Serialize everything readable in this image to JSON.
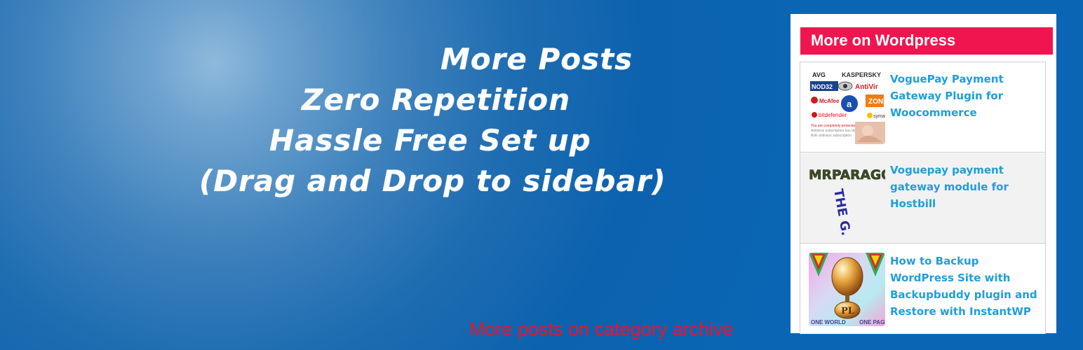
{
  "hero": {
    "lines": [
      "More Posts",
      "Zero Repetition",
      "Hassle Free Set up",
      "(Drag and Drop to sidebar)"
    ],
    "footer_link": "More posts on category archive"
  },
  "widget": {
    "title": "More on Wordpress",
    "posts": [
      {
        "title": "VoguePay Payment Gateway Plugin for Woocommerce",
        "thumbnail": "antivirus-logos-image"
      },
      {
        "title": "Voguepay payment gateway module for Hostbill",
        "thumbnail": "mrparagon-geek-logo-image"
      },
      {
        "title": "How to Backup WordPress Site with Backupbuddy plugin and Restore with InstantWP",
        "thumbnail": "pl-one-world-one-page-logo-image"
      }
    ]
  },
  "colors": {
    "background": "#0a66b5",
    "widget_header": "#f0154f",
    "post_link": "#1f9edc",
    "footer_link": "#e8152d"
  }
}
